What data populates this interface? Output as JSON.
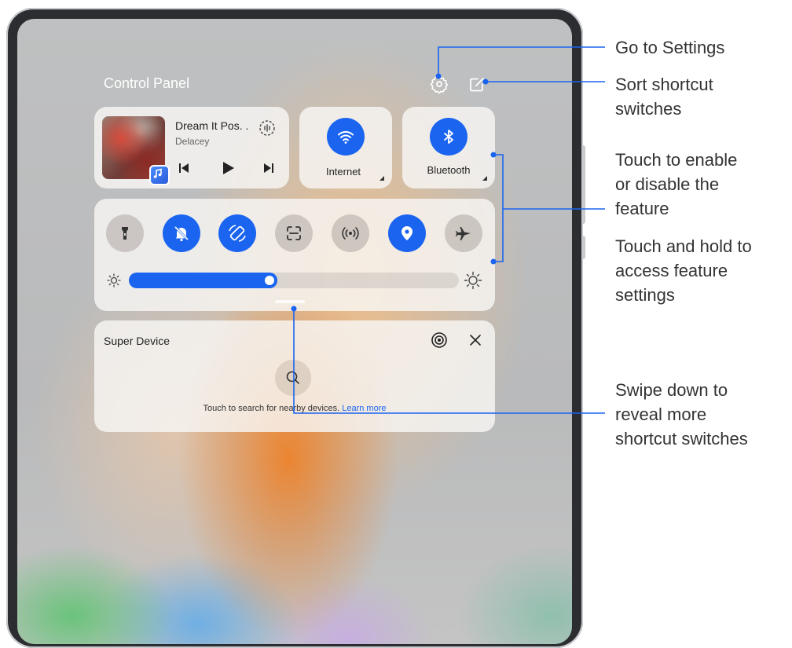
{
  "control_panel": {
    "title": "Control Panel",
    "settings_icon": "gear-icon",
    "edit_icon": "edit-icon"
  },
  "media": {
    "track_title": "Dream It Pos. .",
    "artist": "Delacey",
    "app_icon": "music-app-icon",
    "controls": [
      "previous-icon",
      "play-icon",
      "next-icon"
    ],
    "audio_output_icon": "audio-output-icon"
  },
  "tiles": [
    {
      "label": "Internet",
      "icon": "wifi-icon",
      "enabled": true
    },
    {
      "label": "Bluetooth",
      "icon": "bluetooth-icon",
      "enabled": true
    }
  ],
  "shortcuts": [
    {
      "icon": "flashlight-icon",
      "enabled": false
    },
    {
      "icon": "mute-bell-icon",
      "enabled": true
    },
    {
      "icon": "auto-rotate-icon",
      "enabled": true
    },
    {
      "icon": "scan-icon",
      "enabled": false
    },
    {
      "icon": "hotspot-icon",
      "enabled": false
    },
    {
      "icon": "location-icon",
      "enabled": true
    },
    {
      "icon": "airplane-icon",
      "enabled": false
    }
  ],
  "brightness": {
    "level": 0.45,
    "low_icon": "sun-low-icon",
    "high_icon": "sun-high-icon"
  },
  "super_device": {
    "title": "Super Device",
    "hint": "Touch to search for nearby devices.",
    "link": "Learn more"
  },
  "annotations": {
    "settings": "Go to Settings",
    "sort_1": "Sort shortcut",
    "sort_2": "switches",
    "enable_1": "Touch to enable",
    "enable_2": "or disable the",
    "enable_3": "feature",
    "hold_1": "Touch and hold to",
    "hold_2": "access feature",
    "hold_3": "settings",
    "swipe_1": "Swipe down to",
    "swipe_2": "reveal more",
    "swipe_3": "shortcut switches"
  },
  "colors": {
    "accent": "#1a64f0",
    "callout": "#1a64f0"
  }
}
